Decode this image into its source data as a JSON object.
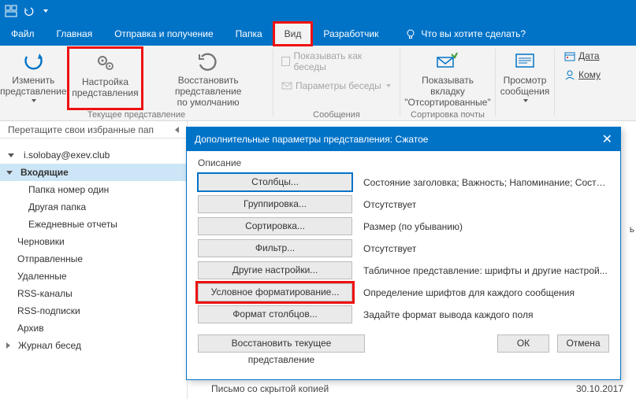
{
  "menubar": {
    "tabs": [
      "Файл",
      "Главная",
      "Отправка и получение",
      "Папка",
      "Вид",
      "Разработчик"
    ],
    "active_index": 4,
    "tellme": "Что вы хотите сделать?"
  },
  "ribbon": {
    "change_view": "Изменить\nпредставление",
    "view_settings": "Настройка\nпредставления",
    "reset_view": "Восстановить представление\nпо умолчанию",
    "group1_label": "Текущее представление",
    "show_conv": "Показывать как беседы",
    "conv_params": "Параметры беседы",
    "group2_label": "Сообщения",
    "show_tab": "Показывать вкладку\n\"Отсортированные\"",
    "group3_label": "Сортировка почты",
    "preview": "Просмотр\nсообщения",
    "date_btn": "Дата",
    "to_btn": "Кому"
  },
  "favorites_hint": "Перетащите свои избранные пап",
  "account": "i.solobay@exev.club",
  "folders": [
    {
      "name": "Входящие",
      "sel": true,
      "exp": true
    },
    {
      "name": "Папка номер один",
      "indent": 1
    },
    {
      "name": "Другая папка",
      "indent": 1
    },
    {
      "name": "Ежедневные отчеты",
      "indent": 1
    },
    {
      "name": "Черновики"
    },
    {
      "name": "Отправленные"
    },
    {
      "name": "Удаленные"
    },
    {
      "name": "RSS-каналы"
    },
    {
      "name": "RSS-подписки"
    },
    {
      "name": "Архив"
    },
    {
      "name": "Журнал бесед",
      "exp": false
    }
  ],
  "dialog": {
    "title": "Дополнительные параметры представления: Сжатое",
    "section": "Описание",
    "rows": [
      {
        "btn": "Столбцы...",
        "desc": "Состояние заголовка; Важность; Напоминание; Состо...",
        "sel": true
      },
      {
        "btn": "Группировка...",
        "desc": "Отсутствует"
      },
      {
        "btn": "Сортировка...",
        "desc": "Размер (по убыванию)"
      },
      {
        "btn": "Фильтр...",
        "desc": "Отсутствует"
      },
      {
        "btn": "Другие настройки...",
        "desc": "Табличное представление: шрифты и другие настрой..."
      },
      {
        "btn": "Условное форматирование...",
        "desc": "Определение шрифтов для каждого сообщения",
        "hl": true
      },
      {
        "btn": "Формат столбцов...",
        "desc": "Задайте формат вывода каждого поля"
      }
    ],
    "restore": "Восстановить текущее представление",
    "ok": "ОК",
    "cancel": "Отмена"
  },
  "msg": {
    "subject": "Письмо со скрытой копией",
    "date": "30.10.2017"
  },
  "side_char": "ь"
}
